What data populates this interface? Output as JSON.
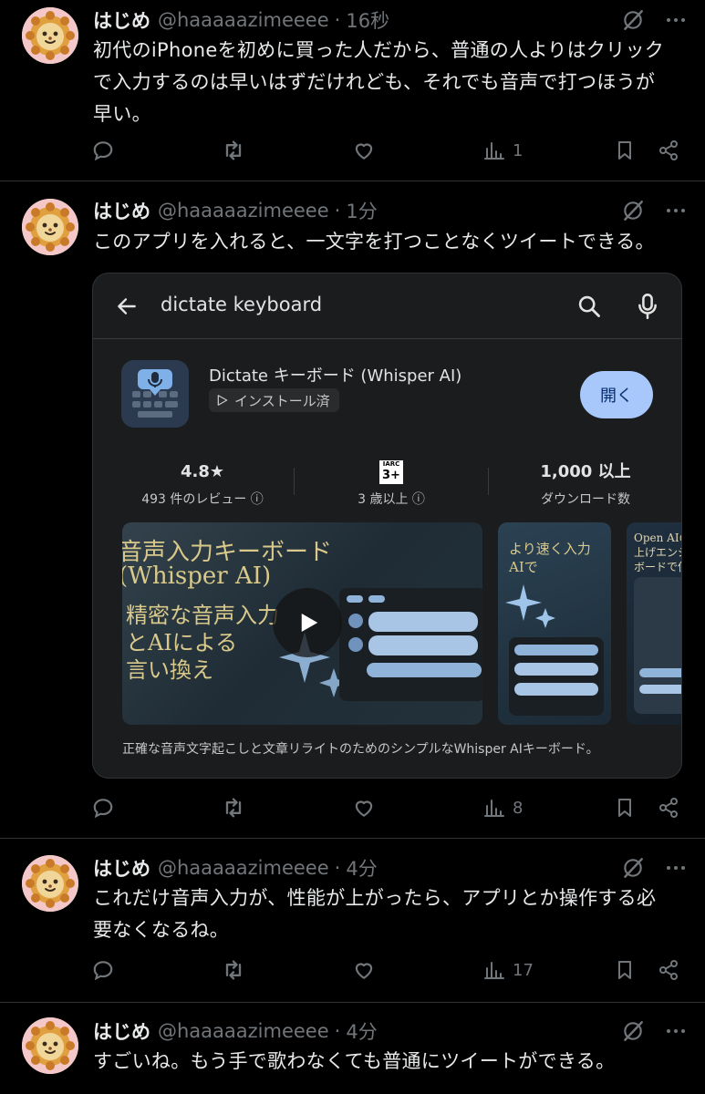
{
  "tweets": [
    {
      "name": "はじめ",
      "handle": "@haaaaazimeeee",
      "time": "16秒",
      "lines": [
        "初代のiPhoneを初めに買った人だから、普通の人よりはクリック",
        "で入力するのは早いはずだけれども、それでも音声で打つほうが",
        "早い。"
      ],
      "views": "1"
    },
    {
      "name": "はじめ",
      "handle": "@haaaaazimeeee",
      "time": "1分",
      "lines": [
        "このアプリを入れると、一文字を打つことなくツイートできる。"
      ],
      "views": "8"
    },
    {
      "name": "はじめ",
      "handle": "@haaaaazimeeee",
      "time": "4分",
      "lines": [
        "これだけ音声入力が、性能が上がったら、アプリとか操作する必",
        "要なくなるね。"
      ],
      "views": "17"
    },
    {
      "name": "はじめ",
      "handle": "@haaaaazimeeee",
      "time": "4分",
      "lines": [
        "すごいね。もう手で歌わなくても普通にツイートができる。"
      ],
      "views": ""
    }
  ],
  "card": {
    "search_query": "dictate keyboard",
    "app_name": "Dictate キーボード (Whisper AI)",
    "installed_label": "インストール済",
    "open_label": "開く",
    "rating": "4.8★",
    "reviews": "493 件のレビュー ⓘ",
    "age_rating_badge": "3+",
    "age_rating_top": "IARC",
    "age": "3 歳以上 ⓘ",
    "downloads": "1,000 以上",
    "downloads_label": "ダウンロード数",
    "screenshot_main_lines": [
      "音声入力キーボード",
      "(Whisper AI)",
      "精密な音声入力",
      "とAIによる",
      "言い換え"
    ],
    "screenshot_2_lines": [
      "より速く入力",
      "AIで"
    ],
    "screenshot_3_lines": [
      "Open AIの",
      "上げエンジ",
      "ボードで使"
    ],
    "description": "正確な音声文字起こしと文章リライトのためのシンプルなWhisper AIキーボード。"
  },
  "colors": {
    "background": "#000000",
    "text": "#e7e9ea",
    "muted": "#71767b",
    "divider": "#2f3336",
    "accent_button": "#a8c7fa"
  },
  "icons": [
    "reply-icon",
    "retweet-icon",
    "like-icon",
    "views-icon",
    "bookmark-icon",
    "share-icon",
    "grok-icon",
    "more-icon",
    "back-arrow-icon",
    "search-icon",
    "mic-icon",
    "play-icon"
  ]
}
